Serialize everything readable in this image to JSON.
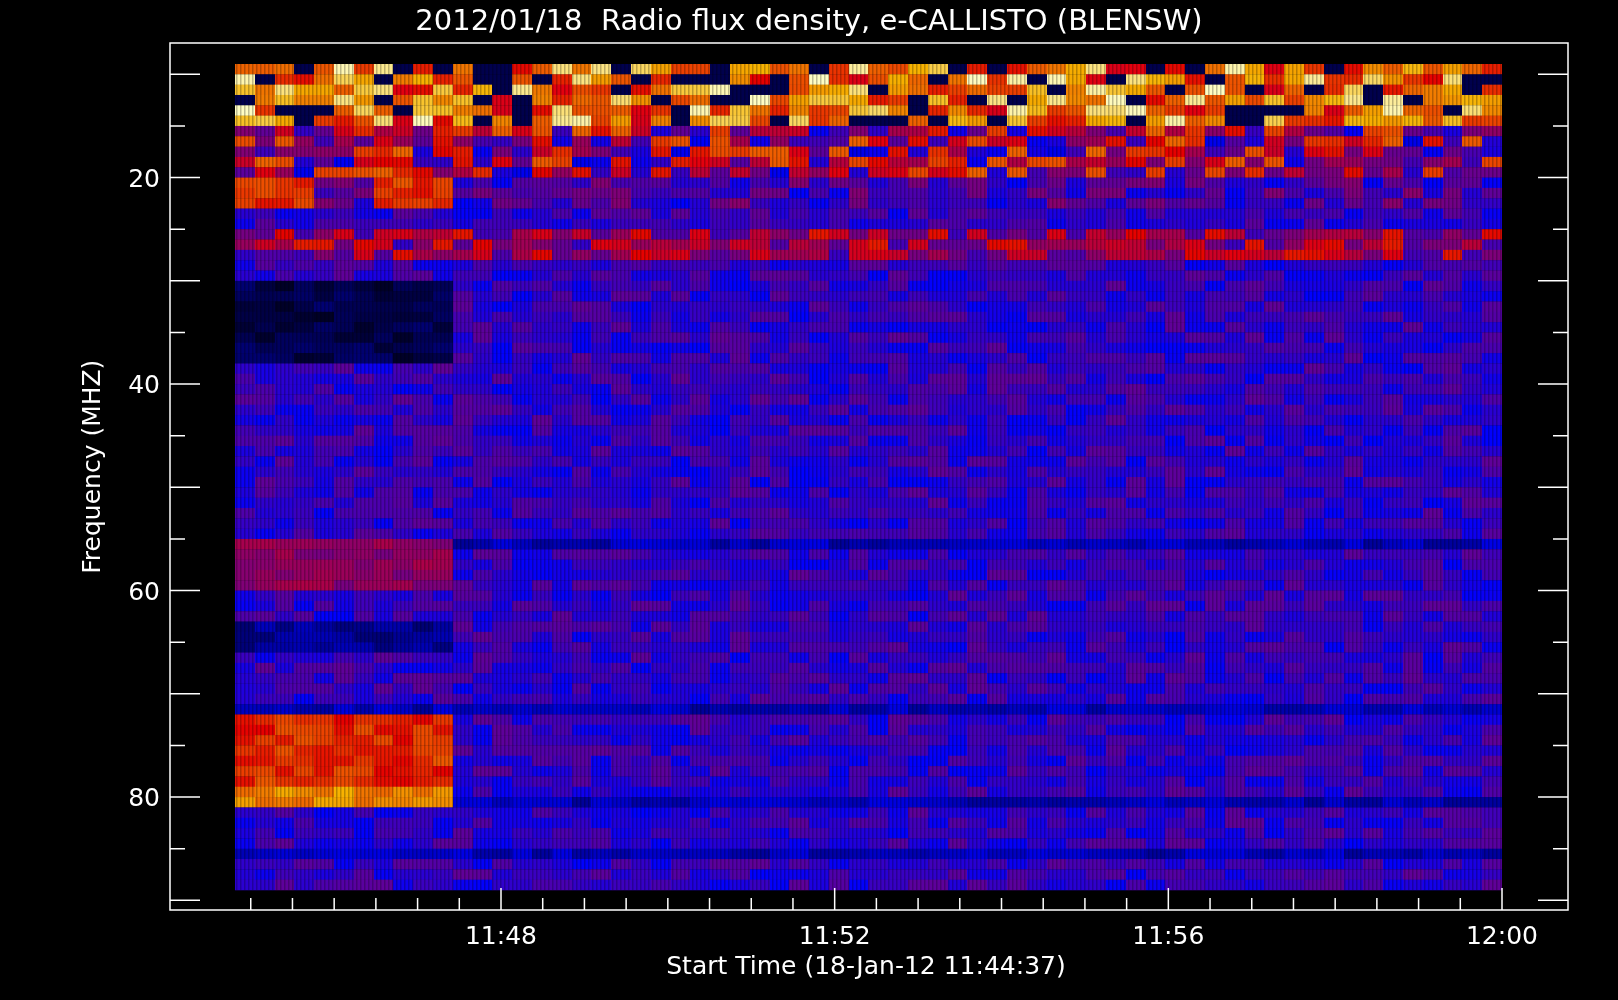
{
  "title": "2012/01/18  Radio flux density, e-CALLISTO (BLENSW)",
  "plot": {
    "ylabel": "Frequency (MHZ)",
    "xlabel": "Start Time (18-Jan-12 11:44:37)",
    "yticks": [
      "20",
      "40",
      "60",
      "80"
    ],
    "xticks": [
      "11:48",
      "11:52",
      "11:56",
      "12:00"
    ]
  }
}
